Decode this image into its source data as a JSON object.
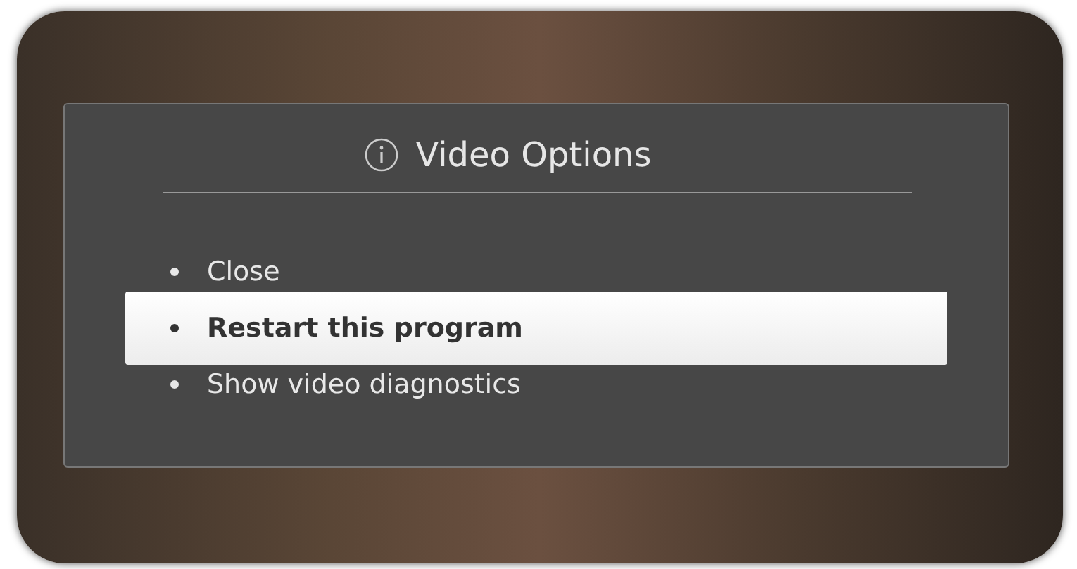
{
  "dialog": {
    "title": "Video Options",
    "items": [
      {
        "label": "Close",
        "selected": false
      },
      {
        "label": "Restart this program",
        "selected": true
      },
      {
        "label": "Show video diagnostics",
        "selected": false
      }
    ]
  }
}
